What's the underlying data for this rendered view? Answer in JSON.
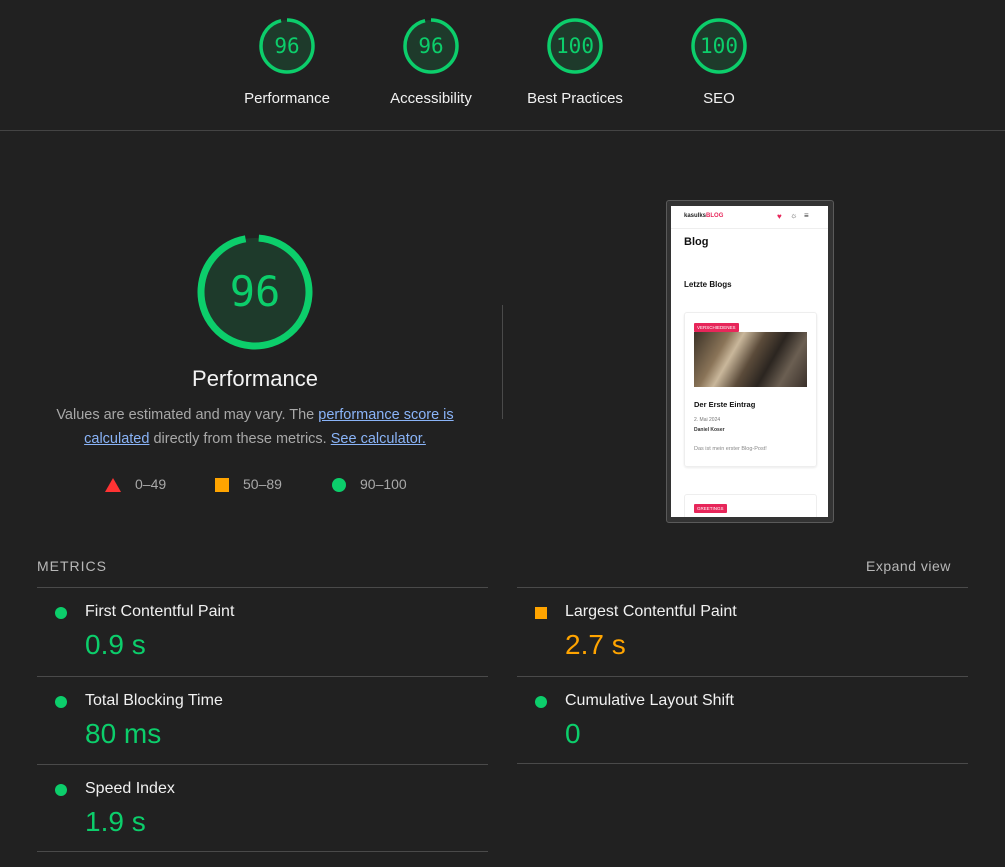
{
  "summary_gauges": [
    {
      "score": "96",
      "label": "Performance"
    },
    {
      "score": "96",
      "label": "Accessibility"
    },
    {
      "score": "100",
      "label": "Best Practices"
    },
    {
      "score": "100",
      "label": "SEO"
    }
  ],
  "performance": {
    "score": "96",
    "title": "Performance",
    "desc_prefix": "Values are estimated and may vary. The ",
    "desc_link1": "performance score is calculated",
    "desc_middle": " directly from these metrics. ",
    "desc_link2": "See calculator."
  },
  "legend": [
    {
      "range": "0–49",
      "shape": "triangle",
      "color": "#ff3333"
    },
    {
      "range": "50–89",
      "shape": "square",
      "color": "#ffa400"
    },
    {
      "range": "90–100",
      "shape": "circle",
      "color": "#0cce6b"
    }
  ],
  "screenshot": {
    "logo_prefix": "kasulks",
    "logo_brand": "BLOG",
    "heading": "Blog",
    "subheading": "Letzte Blogs",
    "card1": {
      "badge": "VERSCHIEDENES",
      "title": "Der Erste Eintrag",
      "date": "2. Mai 2024",
      "author": "Daniel Koser",
      "excerpt": "Das ist mein erster Blog-Post!"
    },
    "card2": {
      "badge": "GREETINGS"
    }
  },
  "metrics_section": {
    "title": "METRICS",
    "expand_label": "Expand view",
    "items": [
      {
        "name": "First Contentful Paint",
        "value": "0.9 s",
        "status": "pass"
      },
      {
        "name": "Largest Contentful Paint",
        "value": "2.7 s",
        "status": "average"
      },
      {
        "name": "Total Blocking Time",
        "value": "80 ms",
        "status": "pass"
      },
      {
        "name": "Cumulative Layout Shift",
        "value": "0",
        "status": "pass"
      },
      {
        "name": "Speed Index",
        "value": "1.9 s",
        "status": "pass"
      }
    ]
  },
  "colors": {
    "pass": "#0cce6b",
    "average": "#ffa400",
    "fail": "#ff3333",
    "background": "#212121"
  }
}
